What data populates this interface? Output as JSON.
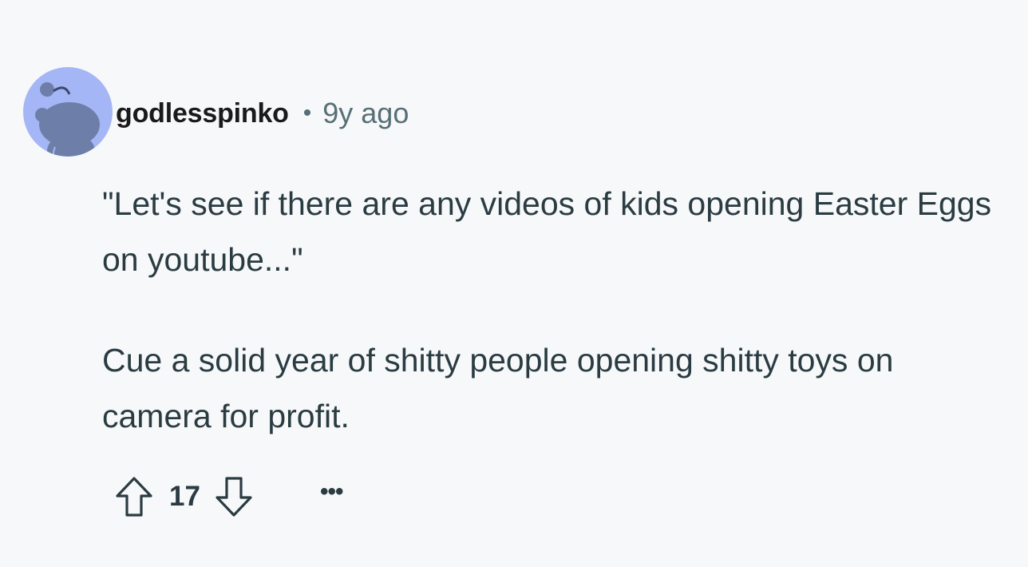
{
  "comment": {
    "username": "godlesspinko",
    "separator": "•",
    "timestamp": "9y ago",
    "paragraphs": [
      "\"Let's see if there are any videos of kids opening Easter Eggs on youtube...\"",
      "Cue a solid year of shitty people opening shitty toys on camera for profit."
    ],
    "score": "17",
    "more_label": "•••",
    "icons": {
      "avatar": "reddit-snoo-avatar-icon",
      "upvote": "upvote-arrow-icon",
      "downvote": "downvote-arrow-icon",
      "more": "ellipsis-icon"
    },
    "colors": {
      "avatar_bg": "#a5b6f6",
      "text": "#2a3c42",
      "meta": "#576f76",
      "background": "#f7f8fa"
    }
  }
}
